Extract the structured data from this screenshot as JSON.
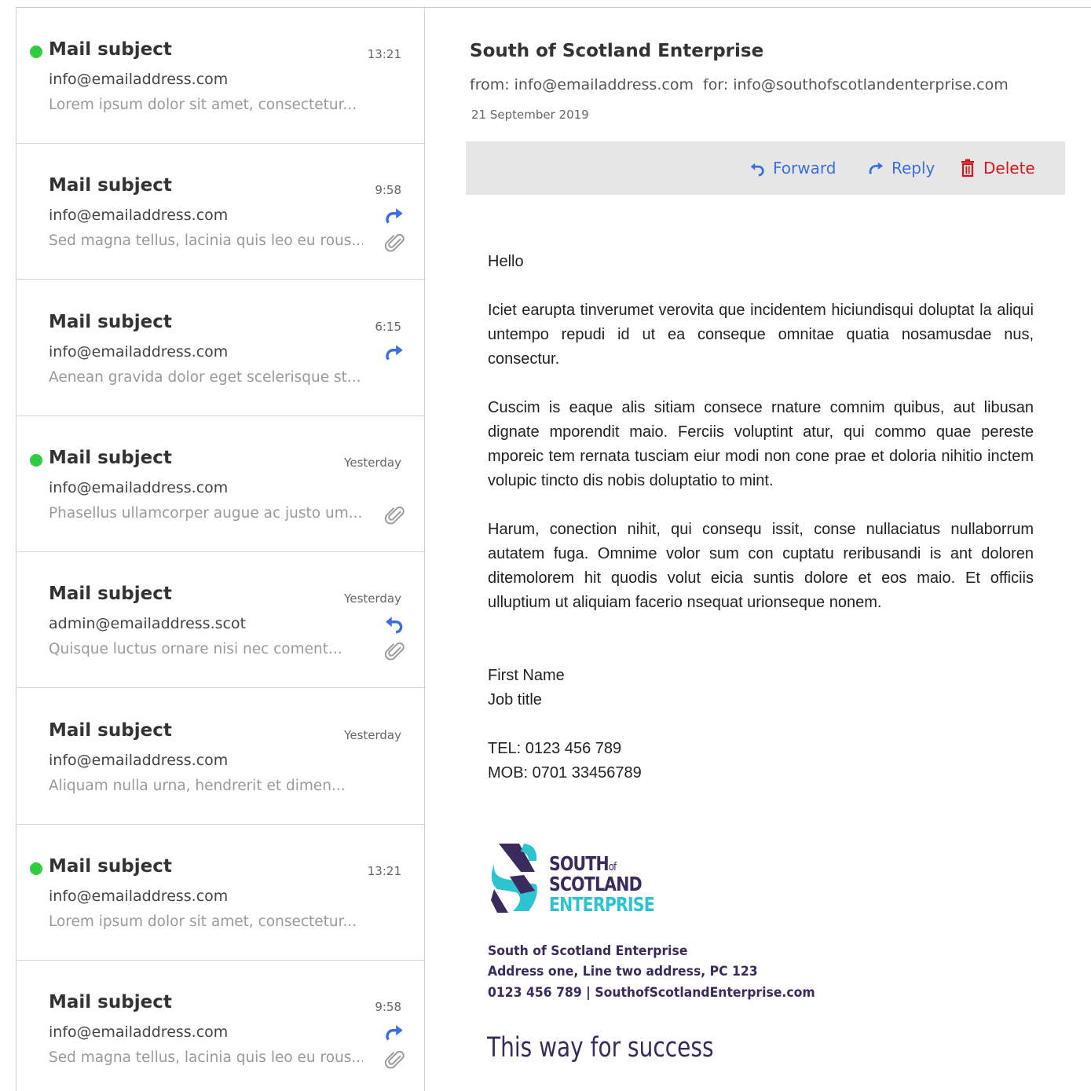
{
  "mail_list": [
    {
      "subject": "Mail subject",
      "time": "13:21",
      "sender": "info@emailaddress.com",
      "preview": "Lorem ipsum dolor sit amet, consectetur...",
      "unread": true,
      "status_icon": "",
      "attachment": false
    },
    {
      "subject": "Mail subject",
      "time": "9:58",
      "sender": "info@emailaddress.com",
      "preview": "Sed magna tellus, lacinia quis leo eu rous...",
      "unread": false,
      "status_icon": "forwarded-icon",
      "attachment": true
    },
    {
      "subject": "Mail subject",
      "time": "6:15",
      "sender": "info@emailaddress.com",
      "preview": "Aenean gravida dolor eget scelerisque st...",
      "unread": false,
      "status_icon": "forwarded-icon",
      "attachment": false
    },
    {
      "subject": "Mail subject",
      "time": "Yesterday",
      "sender": "info@emailaddress.com",
      "preview": "Phasellus ullamcorper augue ac justo um...",
      "unread": true,
      "status_icon": "",
      "attachment": true
    },
    {
      "subject": "Mail subject",
      "time": "Yesterday",
      "sender": "admin@emailaddress.scot",
      "preview": "Quisque luctus ornare nisi nec coment...",
      "unread": false,
      "status_icon": "replied-icon",
      "attachment": true
    },
    {
      "subject": "Mail subject",
      "time": "Yesterday",
      "sender": "info@emailaddress.com",
      "preview": "Aliquam nulla urna, hendrerit et dimen...",
      "unread": false,
      "status_icon": "",
      "attachment": false
    },
    {
      "subject": "Mail subject",
      "time": "13:21",
      "sender": "info@emailaddress.com",
      "preview": "Lorem ipsum dolor sit amet, consectetur...",
      "unread": true,
      "status_icon": "",
      "attachment": false
    },
    {
      "subject": "Mail subject",
      "time": "9:58",
      "sender": "info@emailaddress.com",
      "preview": "Sed magna tellus, lacinia quis leo eu rous...",
      "unread": false,
      "status_icon": "forwarded-icon",
      "attachment": true
    }
  ],
  "email": {
    "title": "South of Scotland Enterprise",
    "from": "from: info@emailaddress.com",
    "to": "for: info@southofscotlandenterprise.com",
    "date": "21 September 2019",
    "greeting": "Hello",
    "paragraphs": [
      "Iciet earupta tinverumet verovita que incidentem hiciundisqui doluptat la aliqui untempo repudi id ut ea conseque omnitae quatia nosamusdae nus, consectur.",
      "Cuscim is eaque alis sitiam consece rnature comnim quibus, aut libusan dignate mporendit maio. Ferciis voluptint atur, qui commo quae pereste mporeic tem rernata tusciam eiur modi non cone prae et doloria nihitio inctem volupic tincto dis nobis doluptatio to mint.",
      "Harum, conection nihit, qui consequ issit, conse nullaciatus nullaborrum autatem fuga. Omnime volor sum con cuptatu reribusandi is ant doloren ditemolorem hit quodis volut eicia suntis dolore et eos maio. Et officiis ulluptium ut aliquiam facerio nsequat urionseque nonem."
    ],
    "signature": {
      "name": "First Name",
      "job_title": "Job title",
      "tel": "TEL: 0123 456 789",
      "mob": "MOB: 0701 33456789"
    },
    "logo": {
      "line1": "SOUTH",
      "line1_small": "of",
      "line2": "SCOTLAND",
      "line3": "ENTERPRISE"
    },
    "company": {
      "name": "South of Scotland Enterprise",
      "address": "Address one, Line two address, PC 123",
      "contact": "0123 456 789  |  SouthofScotlandEnterprise.com"
    },
    "tagline": "This way for success"
  },
  "toolbar": {
    "forward_label": "Forward",
    "reply_label": "Reply",
    "delete_label": "Delete"
  },
  "colors": {
    "accent_blue": "#3d6fe0",
    "delete_red": "#d0181e",
    "unread_green": "#2ecc40",
    "brand_purple": "#3b2a5c",
    "brand_teal": "#2ec4cf",
    "toolbar_bg": "#e6e6e6"
  }
}
